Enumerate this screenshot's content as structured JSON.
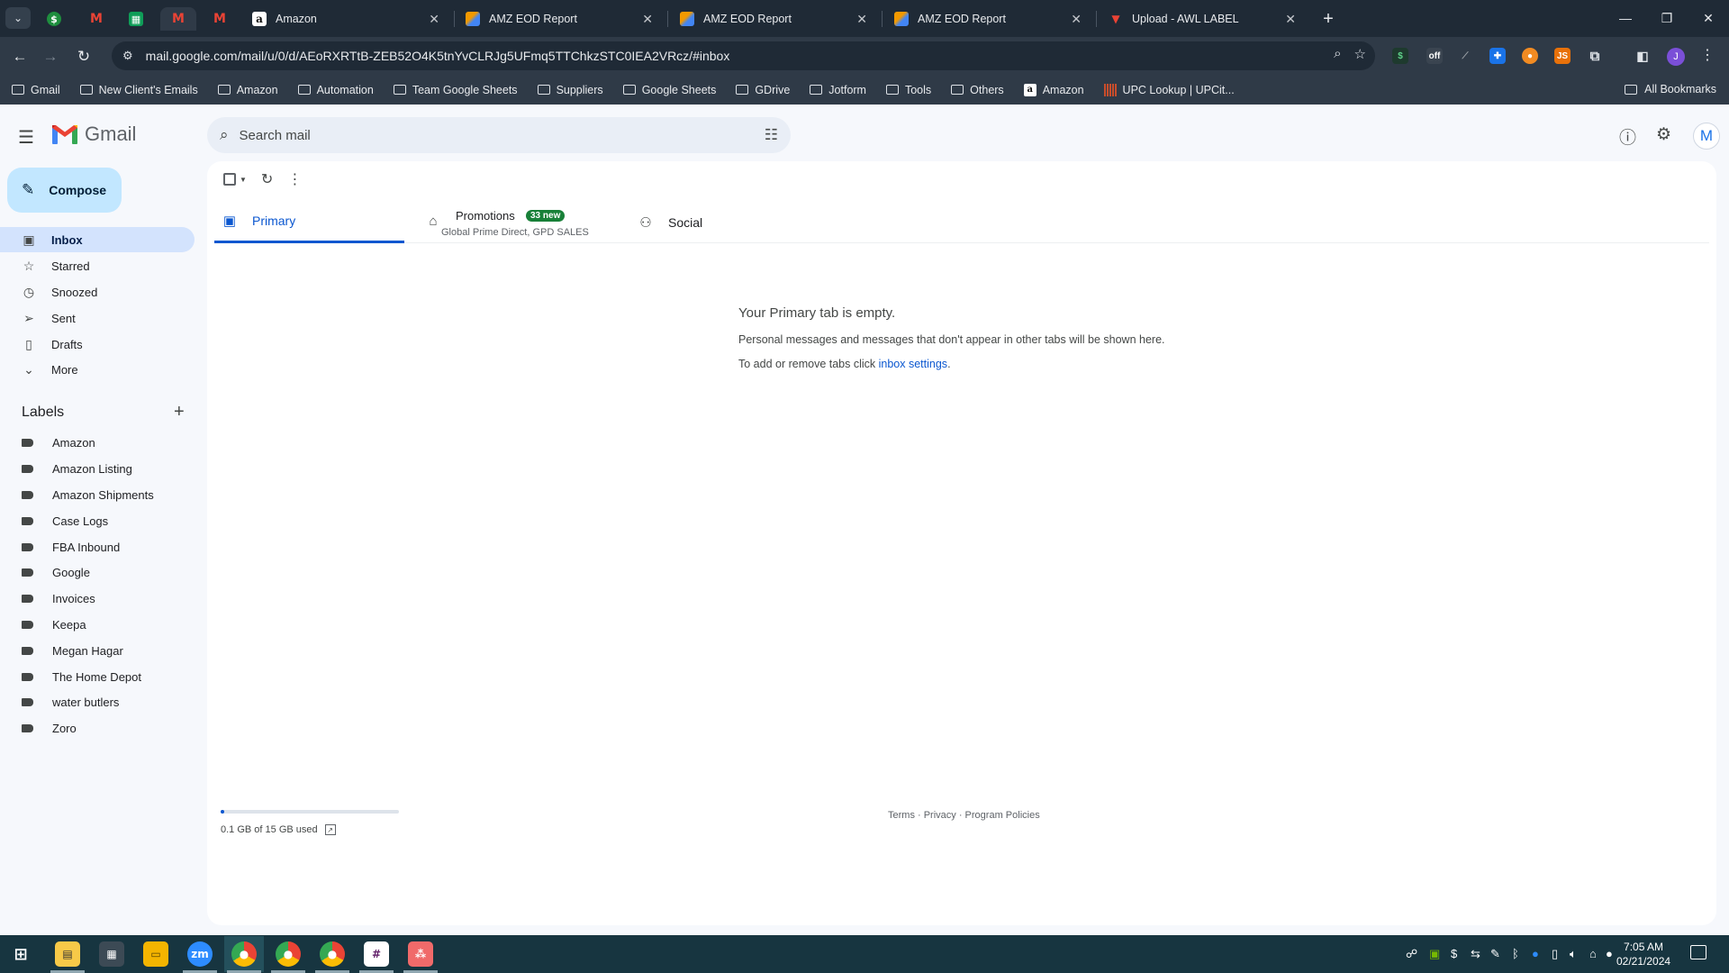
{
  "browser": {
    "tabs": [
      {
        "title": "Amazon"
      },
      {
        "title": "AMZ EOD Report"
      },
      {
        "title": "AMZ EOD Report"
      },
      {
        "title": "AMZ EOD Report"
      },
      {
        "title": "Upload - AWL LABEL"
      }
    ],
    "url": "mail.google.com/mail/u/0/d/AEoRXRTtB-ZEB52O4K5tnYvCLRJg5UFmq5TTChkzSTC0IEA2VRcz/#inbox",
    "bookmarks": [
      "Gmail",
      "New Client's Emails",
      "Amazon",
      "Automation",
      "Team Google Sheets",
      "Suppliers",
      "Google Sheets",
      "GDrive",
      "Jotform",
      "Tools",
      "Others",
      "Amazon",
      "UPC Lookup | UPCit..."
    ],
    "all_bookmarks": "All Bookmarks",
    "profile_initial": "J"
  },
  "gmail": {
    "wordmark": "Gmail",
    "search_placeholder": "Search mail",
    "avatar_initial": "M",
    "compose": "Compose",
    "nav": [
      {
        "label": "Inbox",
        "icon": "inbox-icon"
      },
      {
        "label": "Starred",
        "icon": "star-icon"
      },
      {
        "label": "Snoozed",
        "icon": "clock-icon"
      },
      {
        "label": "Sent",
        "icon": "send-icon"
      },
      {
        "label": "Drafts",
        "icon": "draft-icon"
      },
      {
        "label": "More",
        "icon": "chevron-down-icon"
      }
    ],
    "labels_heading": "Labels",
    "labels": [
      "Amazon",
      "Amazon Listing",
      "Amazon Shipments",
      "Case Logs",
      "FBA Inbound",
      "Google",
      "Invoices",
      "Keepa",
      "Megan Hagar",
      "The Home Depot",
      "water butlers",
      "Zoro"
    ],
    "category_tabs": {
      "primary": "Primary",
      "promotions": "Promotions",
      "promotions_badge": "33 new",
      "promotions_sub": "Global Prime Direct, GPD SALES",
      "social": "Social"
    },
    "empty_state": {
      "title": "Your Primary tab is empty.",
      "line1": "Personal messages and messages that don't appear in other tabs will be shown here.",
      "line2_prefix": "To add or remove tabs click ",
      "line2_link": "inbox settings",
      "line2_suffix": "."
    },
    "storage": {
      "text": "0.1 GB of 15 GB used",
      "used_fraction": 0.007
    },
    "footer": "Terms · Privacy · Program Policies"
  },
  "taskbar": {
    "time": "7:05 AM",
    "date": "02/21/2024"
  },
  "colors": {
    "chrome_dark": "#1f2a36",
    "chrome_toolbar": "#2f3a47",
    "gmail_bg": "#f6f8fc",
    "compose": "#c2e7ff",
    "active_nav": "#d3e3fd",
    "accent": "#0b57d0",
    "badge": "#188038",
    "taskbar": "#173540"
  }
}
